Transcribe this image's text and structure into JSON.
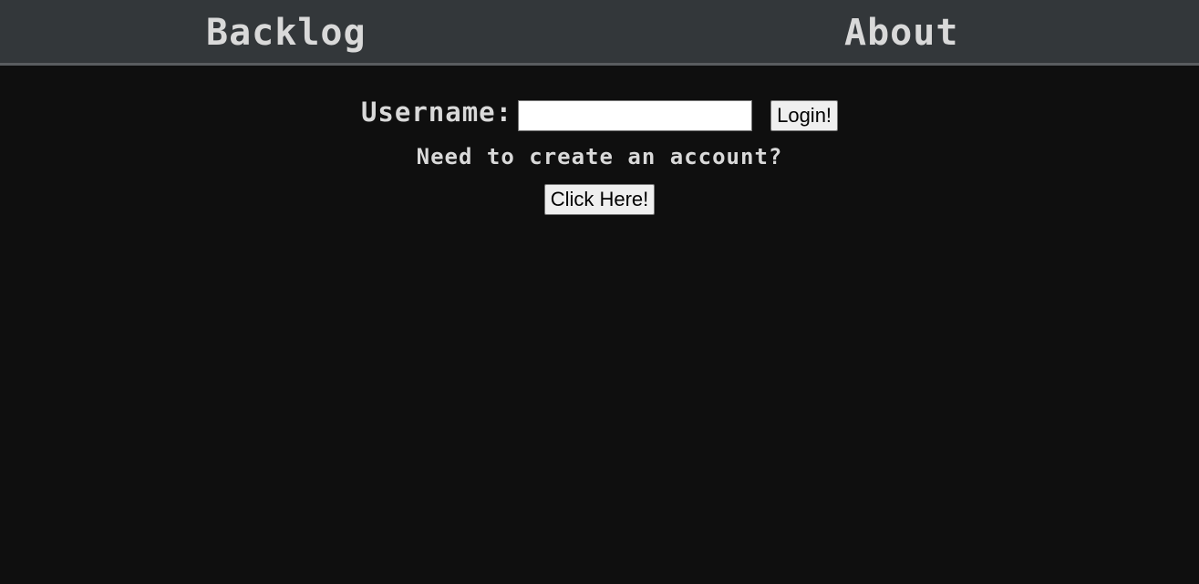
{
  "nav": {
    "backlog_label": "Backlog",
    "about_label": "About"
  },
  "login": {
    "username_label": "Username:",
    "username_value": "",
    "username_placeholder": "",
    "login_button_label": "Login!"
  },
  "signup": {
    "prompt": "Need to create an account?",
    "button_label": "Click Here!"
  },
  "colors": {
    "nav_background": "#33373a",
    "page_background": "#0f0f0f",
    "text": "#d9d9d9"
  }
}
